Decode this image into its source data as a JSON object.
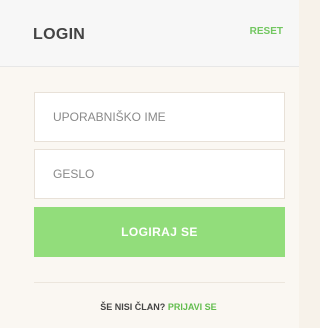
{
  "header": {
    "title": "LOGIN",
    "reset_label": "RESET"
  },
  "form": {
    "username_placeholder": "UPORABNIŠKO IME",
    "password_placeholder": "GESLO",
    "submit_label": "LOGIRAJ SE"
  },
  "footer": {
    "prompt": "ŠE NISI ČLAN?",
    "register_link": "PRIJAVI SE"
  },
  "colors": {
    "accent": "#92dd7b",
    "link": "#62bd4e",
    "background": "#faf7f2"
  }
}
